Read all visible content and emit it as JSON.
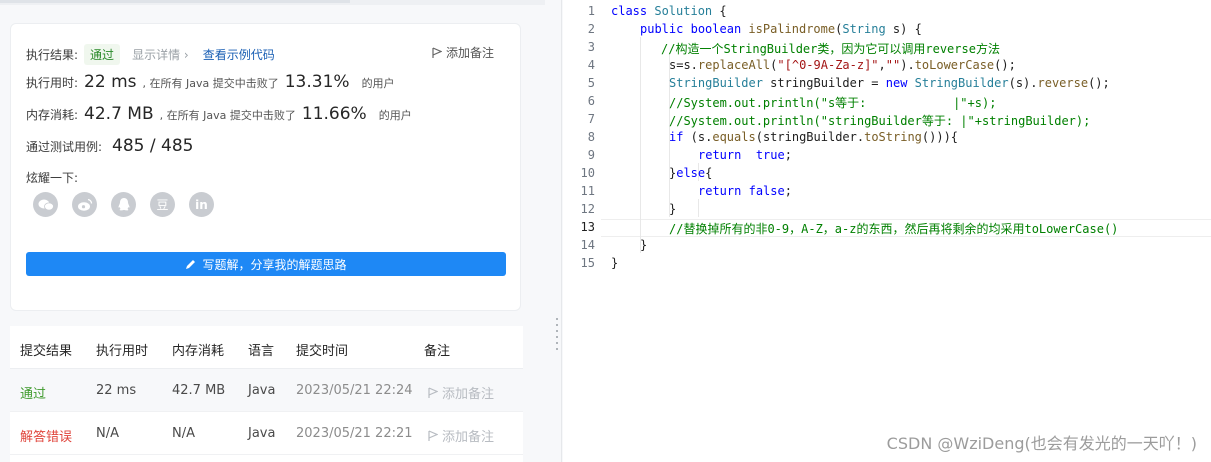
{
  "result": {
    "label": "执行结果:",
    "status": "通过",
    "details_link": "显示详情 ›",
    "sample_link": "查看示例代码",
    "add_note": "添加备注"
  },
  "runtime": {
    "label": "执行用时:",
    "value": "22 ms",
    "mid": ", 在所有 Java 提交中击败了",
    "pct": "13.31%",
    "suffix": "的用户"
  },
  "memory": {
    "label": "内存消耗:",
    "value": "42.7 MB",
    "mid": ", 在所有 Java 提交中击败了",
    "pct": "11.66%",
    "suffix": "的用户"
  },
  "tests": {
    "label": "通过测试用例:",
    "value": "485 / 485"
  },
  "share": {
    "label": "炫耀一下:",
    "icons": [
      "wechat-icon",
      "weibo-icon",
      "qq-icon",
      "douban-icon",
      "linkedin-icon"
    ],
    "douban_glyph": "豆",
    "linkedin_glyph": "in"
  },
  "write_button": "写题解，分享我的解题思路",
  "table": {
    "headers": [
      "提交结果",
      "执行用时",
      "内存消耗",
      "语言",
      "提交时间",
      "备注"
    ],
    "rows": [
      {
        "result": "通过",
        "time": "22 ms",
        "memory": "42.7 MB",
        "lang": "Java",
        "submitted": "2023/05/21 22:24",
        "note": "添加备注"
      },
      {
        "result": "解答错误",
        "time": "N/A",
        "memory": "N/A",
        "lang": "Java",
        "submitted": "2023/05/21 22:21",
        "note": "添加备注"
      }
    ]
  },
  "editor": {
    "line_numbers": [
      "1",
      "2",
      "3",
      "4",
      "5",
      "6",
      "7",
      "8",
      "9",
      "10",
      "11",
      "12",
      "13",
      "14",
      "15"
    ],
    "code": {
      "l1": [
        "class",
        " ",
        "Solution",
        " {"
      ],
      "l2": [
        "public",
        " ",
        "boolean",
        " ",
        "isPalindrome",
        "(",
        "String",
        " s) {"
      ],
      "l3": "//构造一个StringBuilder类，因为它可以调用reverse方法",
      "l4": [
        "s=s.",
        "replaceAll",
        "(",
        "\"[^0-9A-Za-z]\"",
        ",",
        "\"\"",
        ").",
        "toLowerCase",
        "();"
      ],
      "l5": [
        "StringBuilder",
        " stringBuilder = ",
        "new",
        " ",
        "StringBuilder",
        "(s).",
        "reverse",
        "();"
      ],
      "l6": "//System.out.println(\"s等于:            |\"+s);",
      "l7": "//System.out.println(\"stringBuilder等于: |\"+stringBuilder);",
      "l8": [
        "if",
        " (s.",
        "equals",
        "(stringBuilder.",
        "toString",
        "())){"
      ],
      "l9": [
        "return",
        "  ",
        "true",
        ";"
      ],
      "l10": [
        "}",
        "else",
        "{"
      ],
      "l11": [
        "return",
        " ",
        "false",
        ";"
      ],
      "l12": "}",
      "l13": "//替换掉所有的非0-9，A-Z，a-z的东西，然后再将剩余的均采用toLowerCase()",
      "l14": "}",
      "l15": "}"
    }
  },
  "watermark": "CSDN @WziDeng(也会有发光的一天吖！)"
}
